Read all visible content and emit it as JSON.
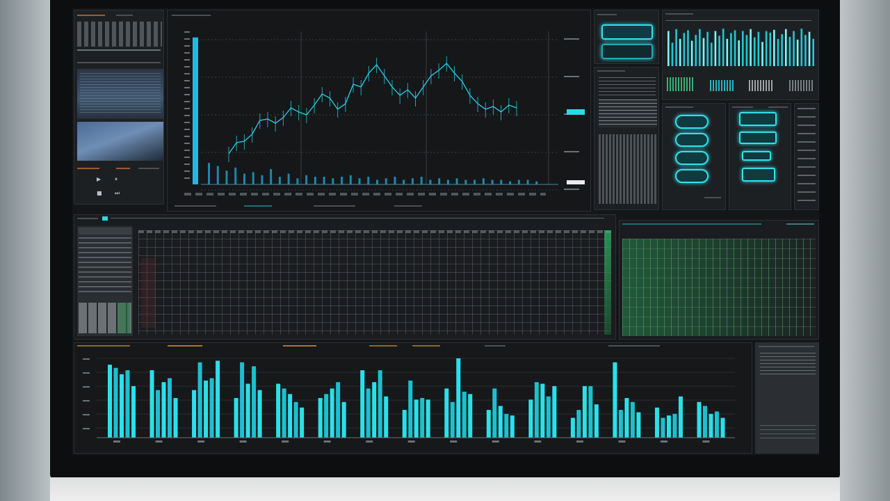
{
  "colors": {
    "accent": "#2bd9e6",
    "accent_light": "#7ef6f8",
    "green": "#2fbf6a",
    "panel": "#1d2023",
    "screen_bg": "#141618"
  },
  "top_left_panel": {
    "icons": [
      "play-icon",
      "pause-icon",
      "stop-icon"
    ]
  },
  "main_chart": {
    "price_levels": [
      0.22,
      0.3,
      0.31,
      0.36,
      0.46,
      0.47,
      0.44,
      0.48,
      0.55,
      0.52,
      0.5,
      0.57,
      0.65,
      0.62,
      0.54,
      0.58,
      0.72,
      0.7,
      0.8,
      0.86,
      0.78,
      0.7,
      0.64,
      0.68,
      0.62,
      0.7,
      0.78,
      0.82,
      0.87,
      0.8,
      0.74,
      0.64,
      0.58,
      0.54,
      0.56,
      0.52,
      0.57,
      0.55
    ],
    "volume_levels": [
      0.14,
      0.12,
      0.09,
      0.11,
      0.07,
      0.08,
      0.06,
      0.1,
      0.05,
      0.07,
      0.04,
      0.06,
      0.05,
      0.05,
      0.04,
      0.05,
      0.06,
      0.04,
      0.05,
      0.03,
      0.04,
      0.05,
      0.03,
      0.04,
      0.05,
      0.03,
      0.04,
      0.03,
      0.04,
      0.03,
      0.03,
      0.04,
      0.03,
      0.03,
      0.02,
      0.03,
      0.03,
      0.02
    ],
    "highlight_level": 0.52,
    "left_bar_level": 0.96
  },
  "right_top": {
    "bar_levels": [
      0.9,
      0.6,
      0.95,
      0.7,
      0.85,
      0.92,
      0.65,
      0.8,
      0.95,
      0.72,
      0.88,
      0.6,
      0.9,
      0.78,
      0.96,
      0.7,
      0.85,
      0.92,
      0.66,
      0.9,
      0.8,
      0.95,
      0.74,
      0.88,
      0.62,
      0.9,
      0.86,
      0.93,
      0.7,
      0.82,
      0.95,
      0.75,
      0.9,
      0.68,
      0.96,
      0.8,
      0.88,
      0.7
    ]
  },
  "bottom_chart": {
    "groups": [
      [
        0.92,
        0.88,
        0.8,
        0.85,
        0.65
      ],
      [
        0.85,
        0.6,
        0.7,
        0.75,
        0.5
      ],
      [
        0.6,
        0.95,
        0.72,
        0.75,
        0.97
      ],
      [
        0.5,
        0.95,
        0.68,
        0.9,
        0.6
      ],
      [
        0.68,
        0.62,
        0.55,
        0.45,
        0.38
      ],
      [
        0.5,
        0.55,
        0.62,
        0.7,
        0.45
      ],
      [
        0.85,
        0.62,
        0.7,
        0.85,
        0.52
      ],
      [
        0.35,
        0.72,
        0.48,
        0.5,
        0.48
      ],
      [
        0.62,
        0.45,
        1.0,
        0.58,
        0.55
      ],
      [
        0.35,
        0.62,
        0.4,
        0.3,
        0.28
      ],
      [
        0.48,
        0.7,
        0.68,
        0.52,
        0.65
      ],
      [
        0.25,
        0.35,
        0.65,
        0.65,
        0.42
      ],
      [
        0.95,
        0.35,
        0.5,
        0.45,
        0.32
      ],
      [
        0.38,
        0.25,
        0.28,
        0.3,
        0.52
      ],
      [
        0.45,
        0.4,
        0.3,
        0.33,
        0.25
      ]
    ]
  }
}
